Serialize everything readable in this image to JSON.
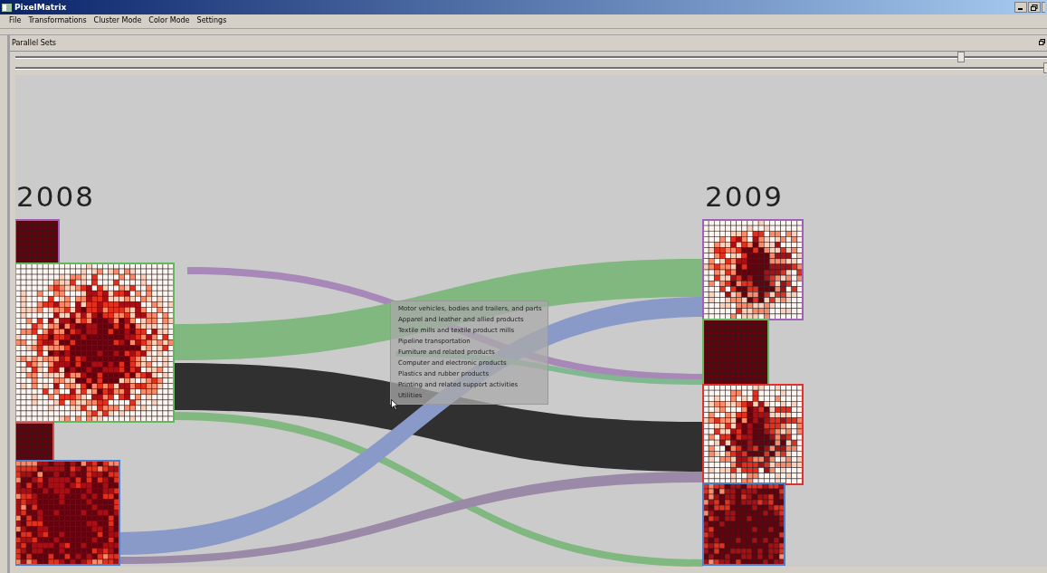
{
  "window": {
    "title": "PixelMatrix"
  },
  "menu": [
    "File",
    "Transformations",
    "Cluster Mode",
    "Color Mode",
    "Settings"
  ],
  "dock": {
    "title": "Parallel Sets"
  },
  "sliders": [
    {
      "level": 0.917
    },
    {
      "level": 1.0
    }
  ],
  "axes": [
    {
      "label": "2008",
      "matrices": [
        {
          "color": "#a060b8"
        },
        {
          "color": "#60b860"
        },
        {
          "color": "#d05050"
        },
        {
          "color": "#4a80c8"
        }
      ]
    },
    {
      "label": "2009",
      "matrices": [
        {
          "color": "#a060b8"
        },
        {
          "color": "#60b860"
        },
        {
          "color": "#e03030"
        },
        {
          "color": "#4a80c8"
        }
      ]
    }
  ],
  "flows": [
    {
      "color": "#a888b8"
    },
    {
      "color": "#80b880"
    },
    {
      "color": "#303030"
    },
    {
      "color": "#80b880"
    },
    {
      "color": "#8a9ac8"
    },
    {
      "color": "#9a8aa8"
    },
    {
      "color": "#80b890"
    }
  ],
  "tooltip": [
    "Motor vehicles, bodies and trailers, and parts",
    "Apparel and leather and allied products",
    "Textile mills and textile product mills",
    "Pipeline transportation",
    "Furniture and related products",
    "Computer and electronic products",
    "Plastics and rubber products",
    "Printing and related support activities",
    "Utilities"
  ]
}
